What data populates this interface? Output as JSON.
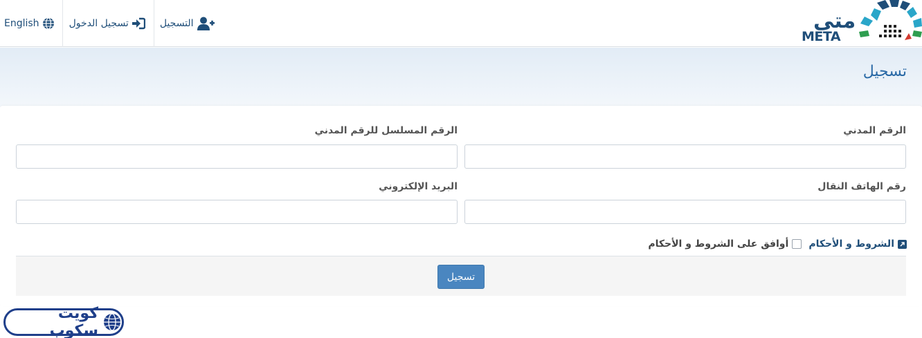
{
  "navbar": {
    "language_label": "English",
    "login_label": "تسجيل الدخول",
    "register_label": "التسجيل"
  },
  "logo": {
    "arabic_text": "متى",
    "latin_text": "META",
    "colors": {
      "dark_blue": "#1f4e79",
      "teal": "#2aa6c9",
      "green": "#2e9e4f",
      "red": "#d23a2f"
    }
  },
  "page": {
    "title": "تسجيل"
  },
  "form": {
    "civil_id_label": "الرقم المدني",
    "civil_id_value": "",
    "serial_label": "الرقم المسلسل للرقم المدني",
    "serial_value": "",
    "mobile_label": "رقم الهاتف النقال",
    "mobile_value": "",
    "email_label": "البريد الإلكتروني",
    "email_value": "",
    "terms_link": "الشروط و الأحكام",
    "agree_label": "أوافق على الشروط و الأحكام",
    "agree_checked": false,
    "submit_label": "تسجيل"
  },
  "watermark": {
    "text": "كويت سكوب"
  },
  "colors": {
    "accent": "#2a6aa6",
    "button": "#4a86c0",
    "nav_text": "#1f4e79"
  }
}
